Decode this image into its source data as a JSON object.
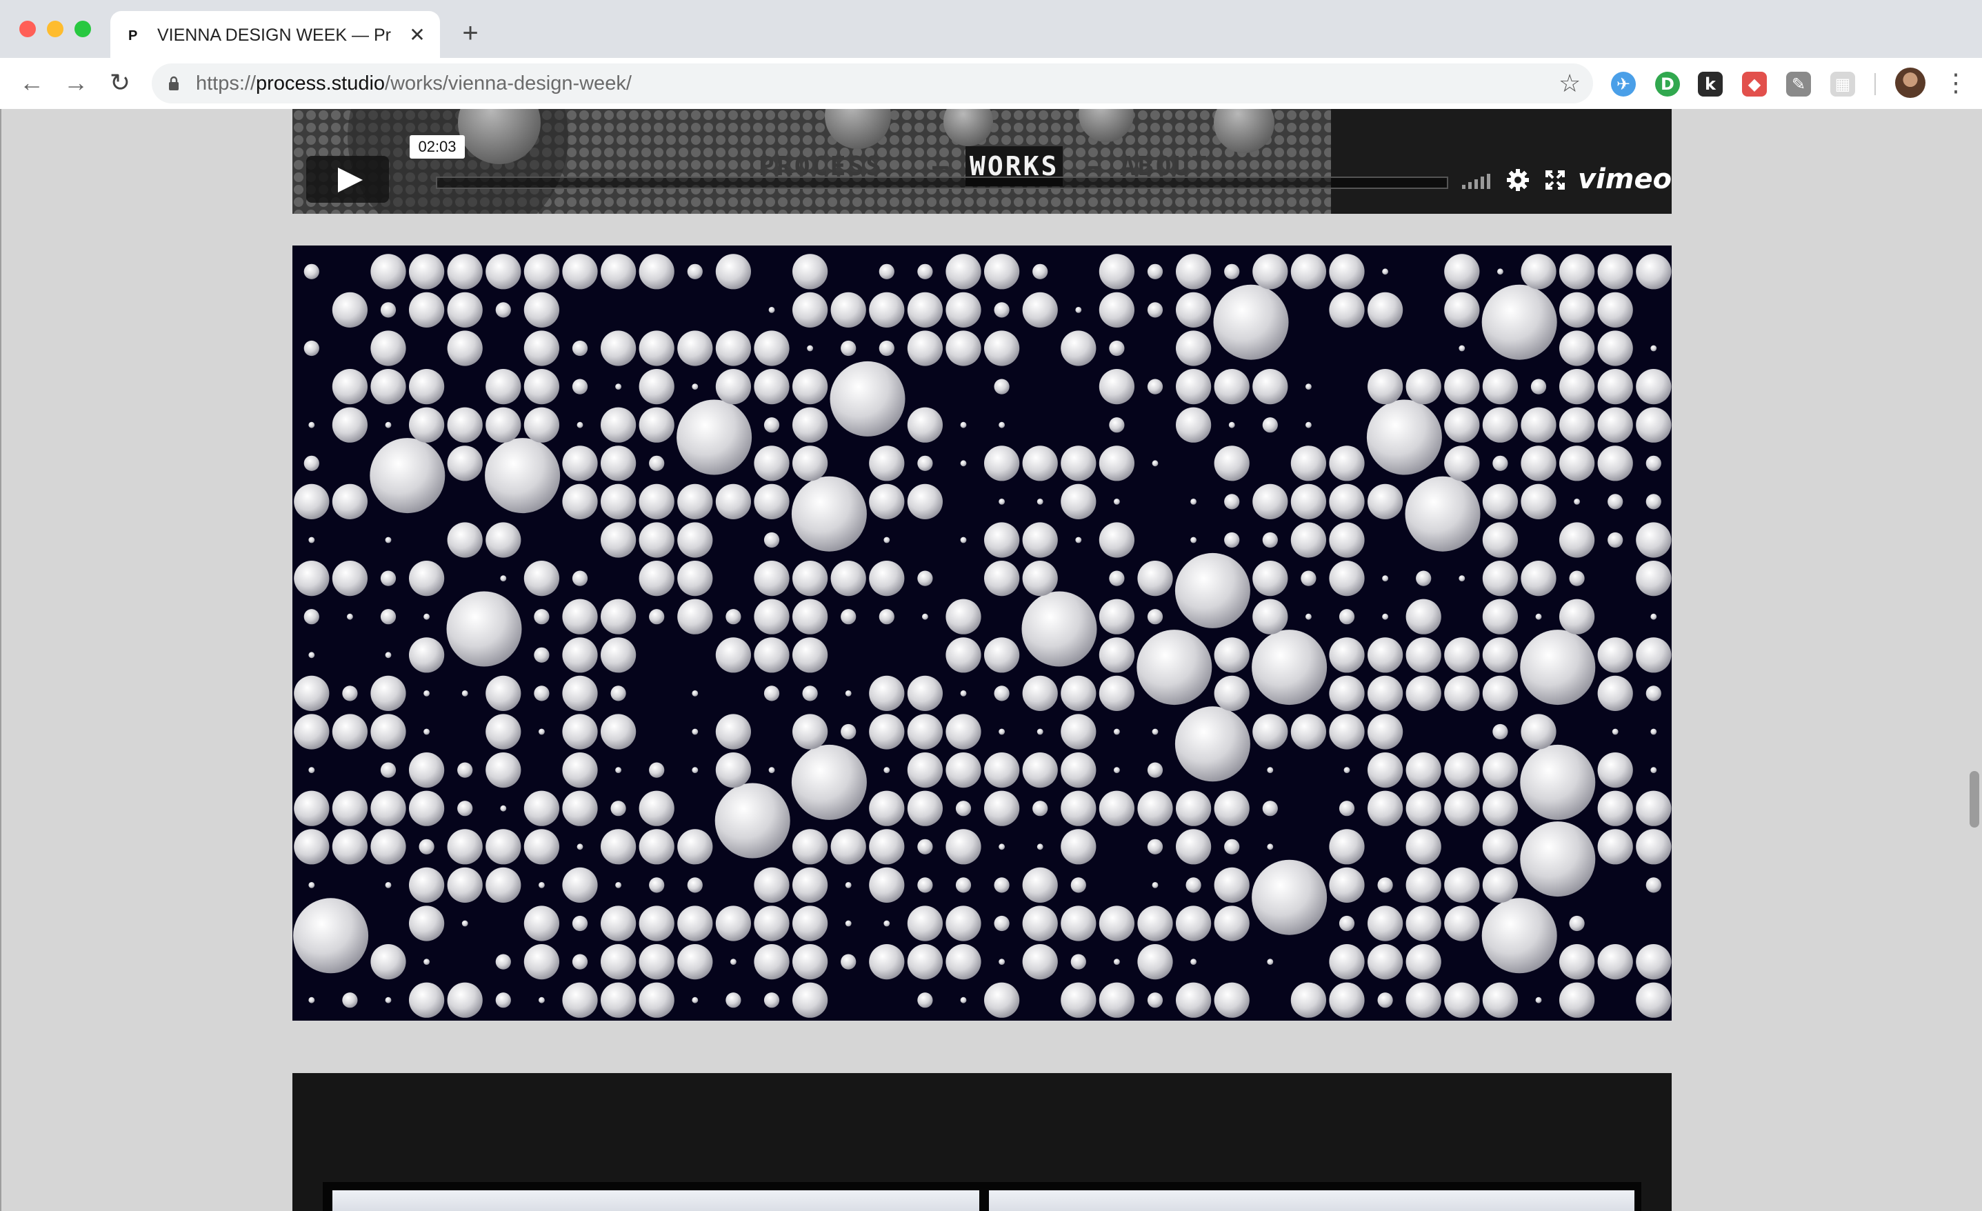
{
  "browser": {
    "tab_title": "VIENNA DESIGN WEEK — Process",
    "tab_favicon_glyph": "P",
    "close_glyph": "✕",
    "new_tab_glyph": "+",
    "url_scheme": "https://",
    "url_host": "process.studio",
    "url_path": "/works/vienna-design-week/",
    "back_glyph": "←",
    "forward_glyph": "→",
    "reload_glyph": "↻",
    "star_glyph": "☆",
    "menu_glyph": "⋮",
    "extensions": [
      {
        "name": "plane-extension-icon",
        "color": "#4a9fe8",
        "glyph": "✈"
      },
      {
        "name": "d-extension-icon",
        "color": "#31a84f",
        "glyph": "D"
      },
      {
        "name": "k-extension-icon",
        "color": "#2b2b2b",
        "glyph": "k"
      },
      {
        "name": "shield-extension-icon",
        "color": "#e2504c",
        "glyph": "◆"
      },
      {
        "name": "pin-extension-icon",
        "color": "#8a8a8a",
        "glyph": "✎"
      },
      {
        "name": "grid-extension-icon",
        "color": "#d8d8d8",
        "glyph": "▦"
      }
    ],
    "traffic_lights": [
      "#ff5f57",
      "#febc2e",
      "#28c840"
    ]
  },
  "video": {
    "nav": {
      "process": "PROCESS",
      "sep1": "—",
      "works": "WORKS",
      "sep2": "—",
      "about": "ABOUT"
    },
    "timestamp": "02:03",
    "logo": "vimeo"
  },
  "colors": {
    "artwork_background": "#05041b",
    "page_background": "#d6d6d6",
    "nav_dim": "#3a3a3a",
    "nav_active_bg": "#161616"
  }
}
